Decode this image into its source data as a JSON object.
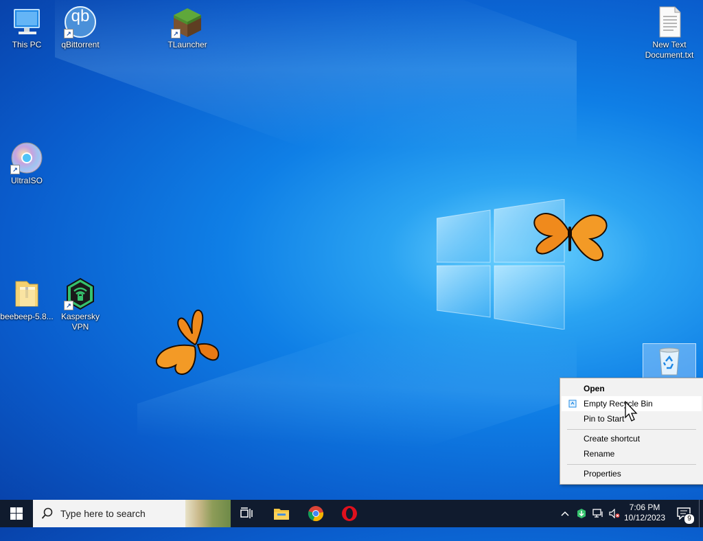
{
  "desktop": {
    "icons": [
      {
        "label": "This PC",
        "icon": "monitor-icon"
      },
      {
        "label": "qBittorrent",
        "icon": "qbittorrent-icon",
        "shortcut": true
      },
      {
        "label": "TLauncher",
        "icon": "grass-block-icon",
        "shortcut": true
      },
      {
        "label": "New Text Document.txt",
        "line1": "New Text",
        "line2": "Document.txt",
        "icon": "text-file-icon"
      },
      {
        "label": "UltraISO",
        "icon": "disc-icon",
        "shortcut": true
      },
      {
        "label": "beebeep-5.8...",
        "icon": "folder-zip-icon"
      },
      {
        "label": "Kaspersky VPN",
        "line1": "Kaspersky",
        "line2": "VPN",
        "icon": "shield-wifi-icon",
        "shortcut": true
      },
      {
        "label": "Recycle Bin",
        "icon": "recycle-bin-icon",
        "selected": true
      }
    ],
    "qb_glyph": "qb"
  },
  "context_menu": {
    "items": [
      {
        "label": "Open",
        "bold": true
      },
      {
        "label": "Empty Recycle Bin",
        "icon": "recycle-small-icon",
        "highlighted": true
      },
      {
        "label": "Pin to Start"
      },
      {
        "label": "Create shortcut"
      },
      {
        "label": "Rename"
      },
      {
        "label": "Properties"
      }
    ]
  },
  "taskbar": {
    "search_placeholder": "Type here to search",
    "pinned": [
      "task-view-icon",
      "file-explorer-icon",
      "chrome-icon",
      "opera-icon"
    ],
    "tray_icons": [
      "chevron-up-icon",
      "kaspersky-tray-icon",
      "network-icon",
      "volume-muted-icon"
    ],
    "time": "7:06 PM",
    "date": "10/12/2023",
    "notification_count": "9"
  },
  "colors": {
    "taskbar_bg": "#101b2e",
    "desktop_accent": "#0a72e0",
    "menu_bg": "#f2f2f2"
  }
}
